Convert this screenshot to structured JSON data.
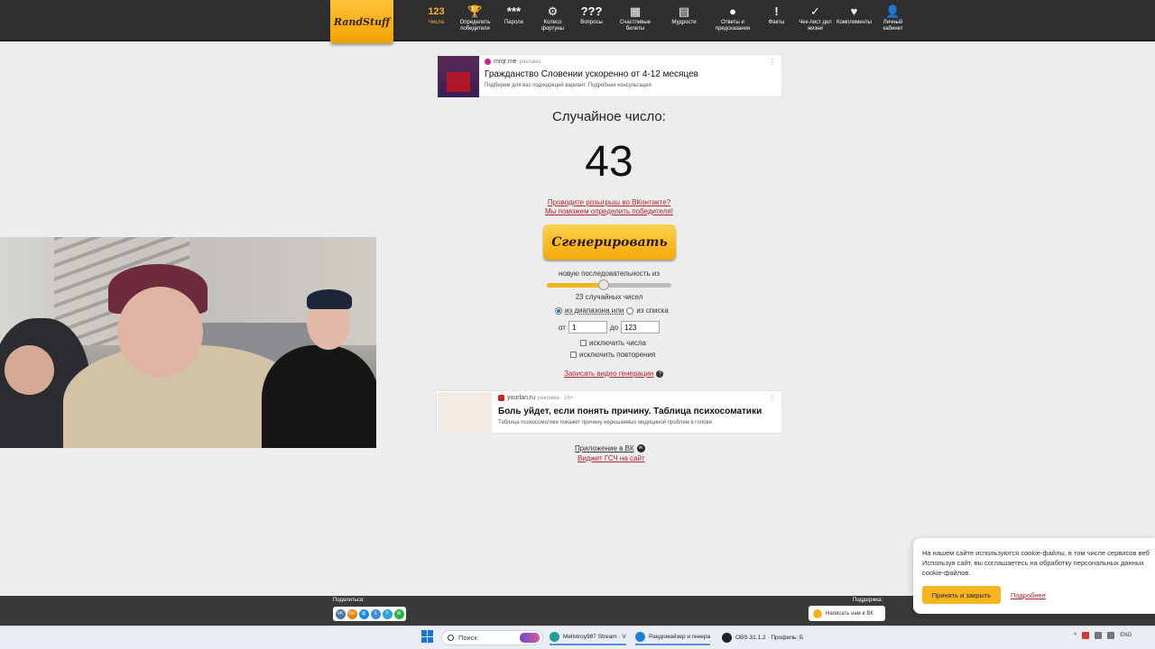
{
  "brand": {
    "logo_text": "RandStuff"
  },
  "nav": [
    {
      "icon_text": "123",
      "label": "Числа",
      "active": true,
      "icon": "numbers-icon"
    },
    {
      "icon_text": "🏆",
      "label": "Определить победителя",
      "active": false,
      "icon": "trophy-icon"
    },
    {
      "icon_text": "***",
      "label": "Пароли",
      "active": false,
      "icon": "password-icon"
    },
    {
      "icon_text": "⚙",
      "label": "Колесо фортуны",
      "active": false,
      "icon": "wheel-icon"
    },
    {
      "icon_text": "???",
      "label": "Вопросы",
      "active": false,
      "icon": "questions-icon"
    },
    {
      "icon_text": "▦",
      "label": "Счастливые билеты",
      "active": false,
      "icon": "ticket-icon"
    },
    {
      "icon_text": "▤",
      "label": "Мудрости",
      "active": false,
      "icon": "book-icon"
    },
    {
      "icon_text": "●",
      "label": "Ответы и предсказания",
      "active": false,
      "icon": "ball-icon"
    },
    {
      "icon_text": "!",
      "label": "Факты",
      "active": false,
      "icon": "facts-icon"
    },
    {
      "icon_text": "✓",
      "label": "Чек-лист дел жизни",
      "active": false,
      "icon": "checklist-icon"
    },
    {
      "icon_text": "♥",
      "label": "Комплименты",
      "active": false,
      "icon": "heart-icon"
    },
    {
      "icon_text": "👤",
      "label": "Личный кабинет",
      "active": false,
      "icon": "user-icon"
    }
  ],
  "ad_top": {
    "source": "mrqr.me",
    "tag": "реклама",
    "title": "Гражданство Словении ускоренно от 4-12 месяцев",
    "subtitle": "Подберем для вас подходящий вариант. Подробная консультация"
  },
  "main": {
    "title": "Случайное число:",
    "number": "43",
    "promo_line1": "Проводите розыгрыш во ВКонтакте?",
    "promo_line2": "Мы поможем определить победителя!",
    "generate_label": "Сгенерировать",
    "sequence_label": "новую последовательность из",
    "slider_fraction": 0.45,
    "count_label": "23 случайных чисел",
    "radio_range_label": "из диапазона или",
    "radio_list_label": "из списка",
    "from_label": "от",
    "from_value": "1",
    "to_label": "до",
    "to_value": "123",
    "exclude_numbers_label": "исключить числа",
    "exclude_repeats_label": "исключить повторения",
    "record_video_label": "Записать видео генерации",
    "app_vk_label": "Приложение в ВК",
    "widget_label": "Виджет ГСЧ на сайт"
  },
  "ad_bottom": {
    "source": "yourlan.ru",
    "tag": "реклама · 16+",
    "title": "Боль уйдет, если понять причину. Таблица психосоматики",
    "subtitle": "Таблица психосоматики покажет причину нерешаемых медициной проблем в голове"
  },
  "footer": {
    "share_label": "Поделиться:",
    "share_buttons": [
      {
        "text": "VK",
        "color": "#4a76a8"
      },
      {
        "text": "OK",
        "color": "#ee8208"
      },
      {
        "text": "@",
        "color": "#168de2"
      },
      {
        "text": "S",
        "color": "#3b8be0"
      },
      {
        "text": "T",
        "color": "#2aa3de"
      },
      {
        "text": "W",
        "color": "#25b43f"
      }
    ],
    "support_label": "Поддержка:",
    "support_button": "Написать нам в ВК"
  },
  "cookie": {
    "line1": "На нашем сайте используются cookie-файлы, в том числе сервисов веб",
    "line2": "Используя сайт, вы соглашаетесь на обработку персональных данных",
    "line3": "cookie-файлов.",
    "accept_label": "Принять и закрыть",
    "more_label": "Подробнее"
  },
  "taskbar": {
    "search_placeholder": "Поиск",
    "tasks": [
      {
        "label": "Mellstroy987 Stream · V"
      },
      {
        "label": "Рандомайзер и генера"
      },
      {
        "label": "OBS 31.1.2 · Профиль: Б"
      }
    ],
    "lang": "ENG"
  },
  "colors": {
    "accent": "#f6b51e",
    "link": "#b3262f",
    "topbar": "#2f2f2f"
  }
}
